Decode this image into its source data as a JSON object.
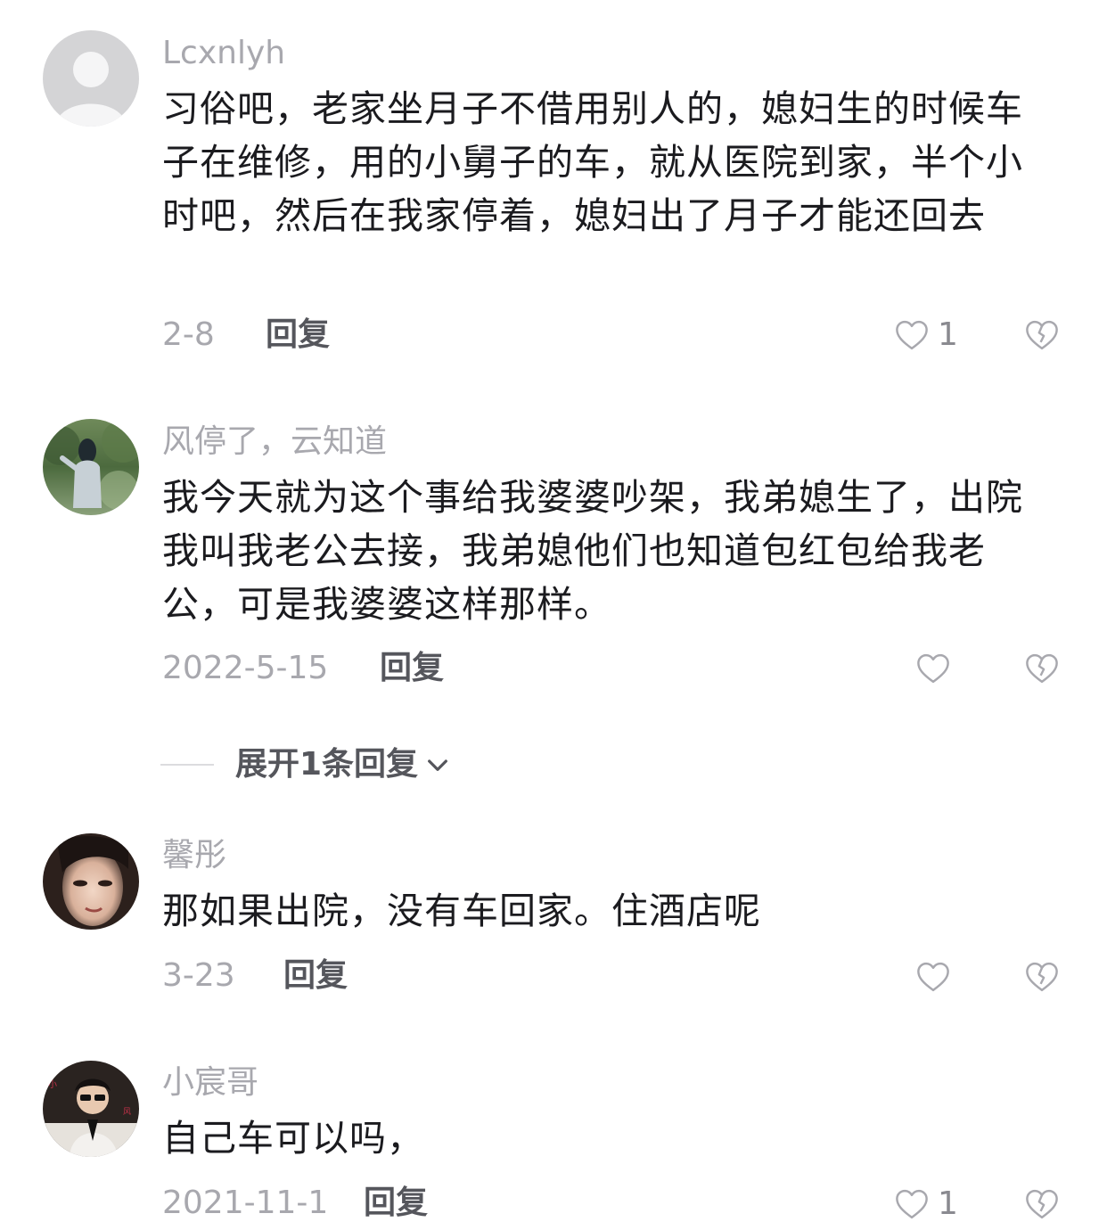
{
  "comments": [
    {
      "username": "Lcxnlyh",
      "text": "习俗吧，老家坐月子不借用别人的，媳妇生的时候车子在维修，用的小舅子的车，就从医院到家，半个小时吧，然后在我家停着，媳妇出了月子才能还回去",
      "date": "2-8",
      "reply_label": "回复",
      "likes": "1",
      "avatar": "default-avatar-icon"
    },
    {
      "username": "风停了，云知道",
      "text": "我今天就为这个事给我婆婆吵架，我弟媳生了，出院我叫我老公去接，我弟媳他们也知道包红包给我老公，可是我婆婆这样那样。",
      "date": "2022-5-15",
      "reply_label": "回复",
      "likes": "",
      "avatar": "photo-avatar-forest"
    },
    {
      "username": "馨彤",
      "text": "那如果出院，没有车回家。住酒店呢",
      "date": "3-23",
      "reply_label": "回复",
      "likes": "",
      "avatar": "photo-avatar-portrait"
    },
    {
      "username": "小宸哥",
      "text": "自己车可以吗，",
      "date": "2021-11-1",
      "reply_label": "回复",
      "likes": "1",
      "avatar": "photo-avatar-boy"
    }
  ],
  "expand_replies": {
    "label": "展开1条回复"
  },
  "colors": {
    "text_primary": "#1b1b1f",
    "text_secondary": "#a8a8ae",
    "reply": "#55565c",
    "divider": "#dcdcdf"
  }
}
